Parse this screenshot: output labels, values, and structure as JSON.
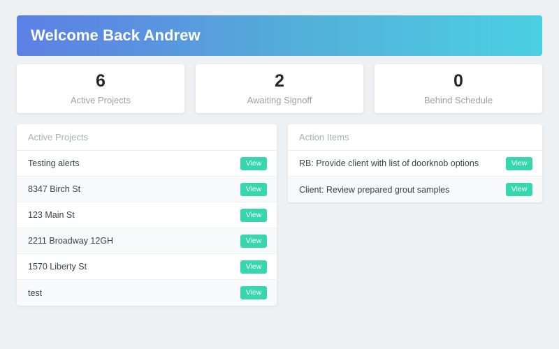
{
  "banner": {
    "title": "Welcome Back Andrew"
  },
  "stats": [
    {
      "value": "6",
      "label": "Active Projects"
    },
    {
      "value": "2",
      "label": "Awaiting Signoff"
    },
    {
      "value": "0",
      "label": "Behind Schedule"
    }
  ],
  "active_projects": {
    "header": "Active Projects",
    "rows": [
      {
        "name": "Testing alerts",
        "action": "View"
      },
      {
        "name": "8347 Birch St",
        "action": "View"
      },
      {
        "name": "123 Main St",
        "action": "View"
      },
      {
        "name": "2211 Broadway 12GH",
        "action": "View"
      },
      {
        "name": "1570 Liberty St",
        "action": "View"
      },
      {
        "name": "test",
        "action": "View"
      }
    ]
  },
  "action_items": {
    "header": "Action Items",
    "rows": [
      {
        "name": "RB: Provide client with list of doorknob options",
        "action": "View"
      },
      {
        "name": "Client: Review prepared grout samples",
        "action": "View"
      }
    ]
  },
  "colors": {
    "banner_start": "#5c80e4",
    "banner_end": "#4bd0e3",
    "accent_button": "#36d6ae",
    "page_background": "#eef1f4",
    "card_background": "#ffffff",
    "row_alt_background": "#f8f9fa",
    "muted_text": "#a9aeb5"
  }
}
